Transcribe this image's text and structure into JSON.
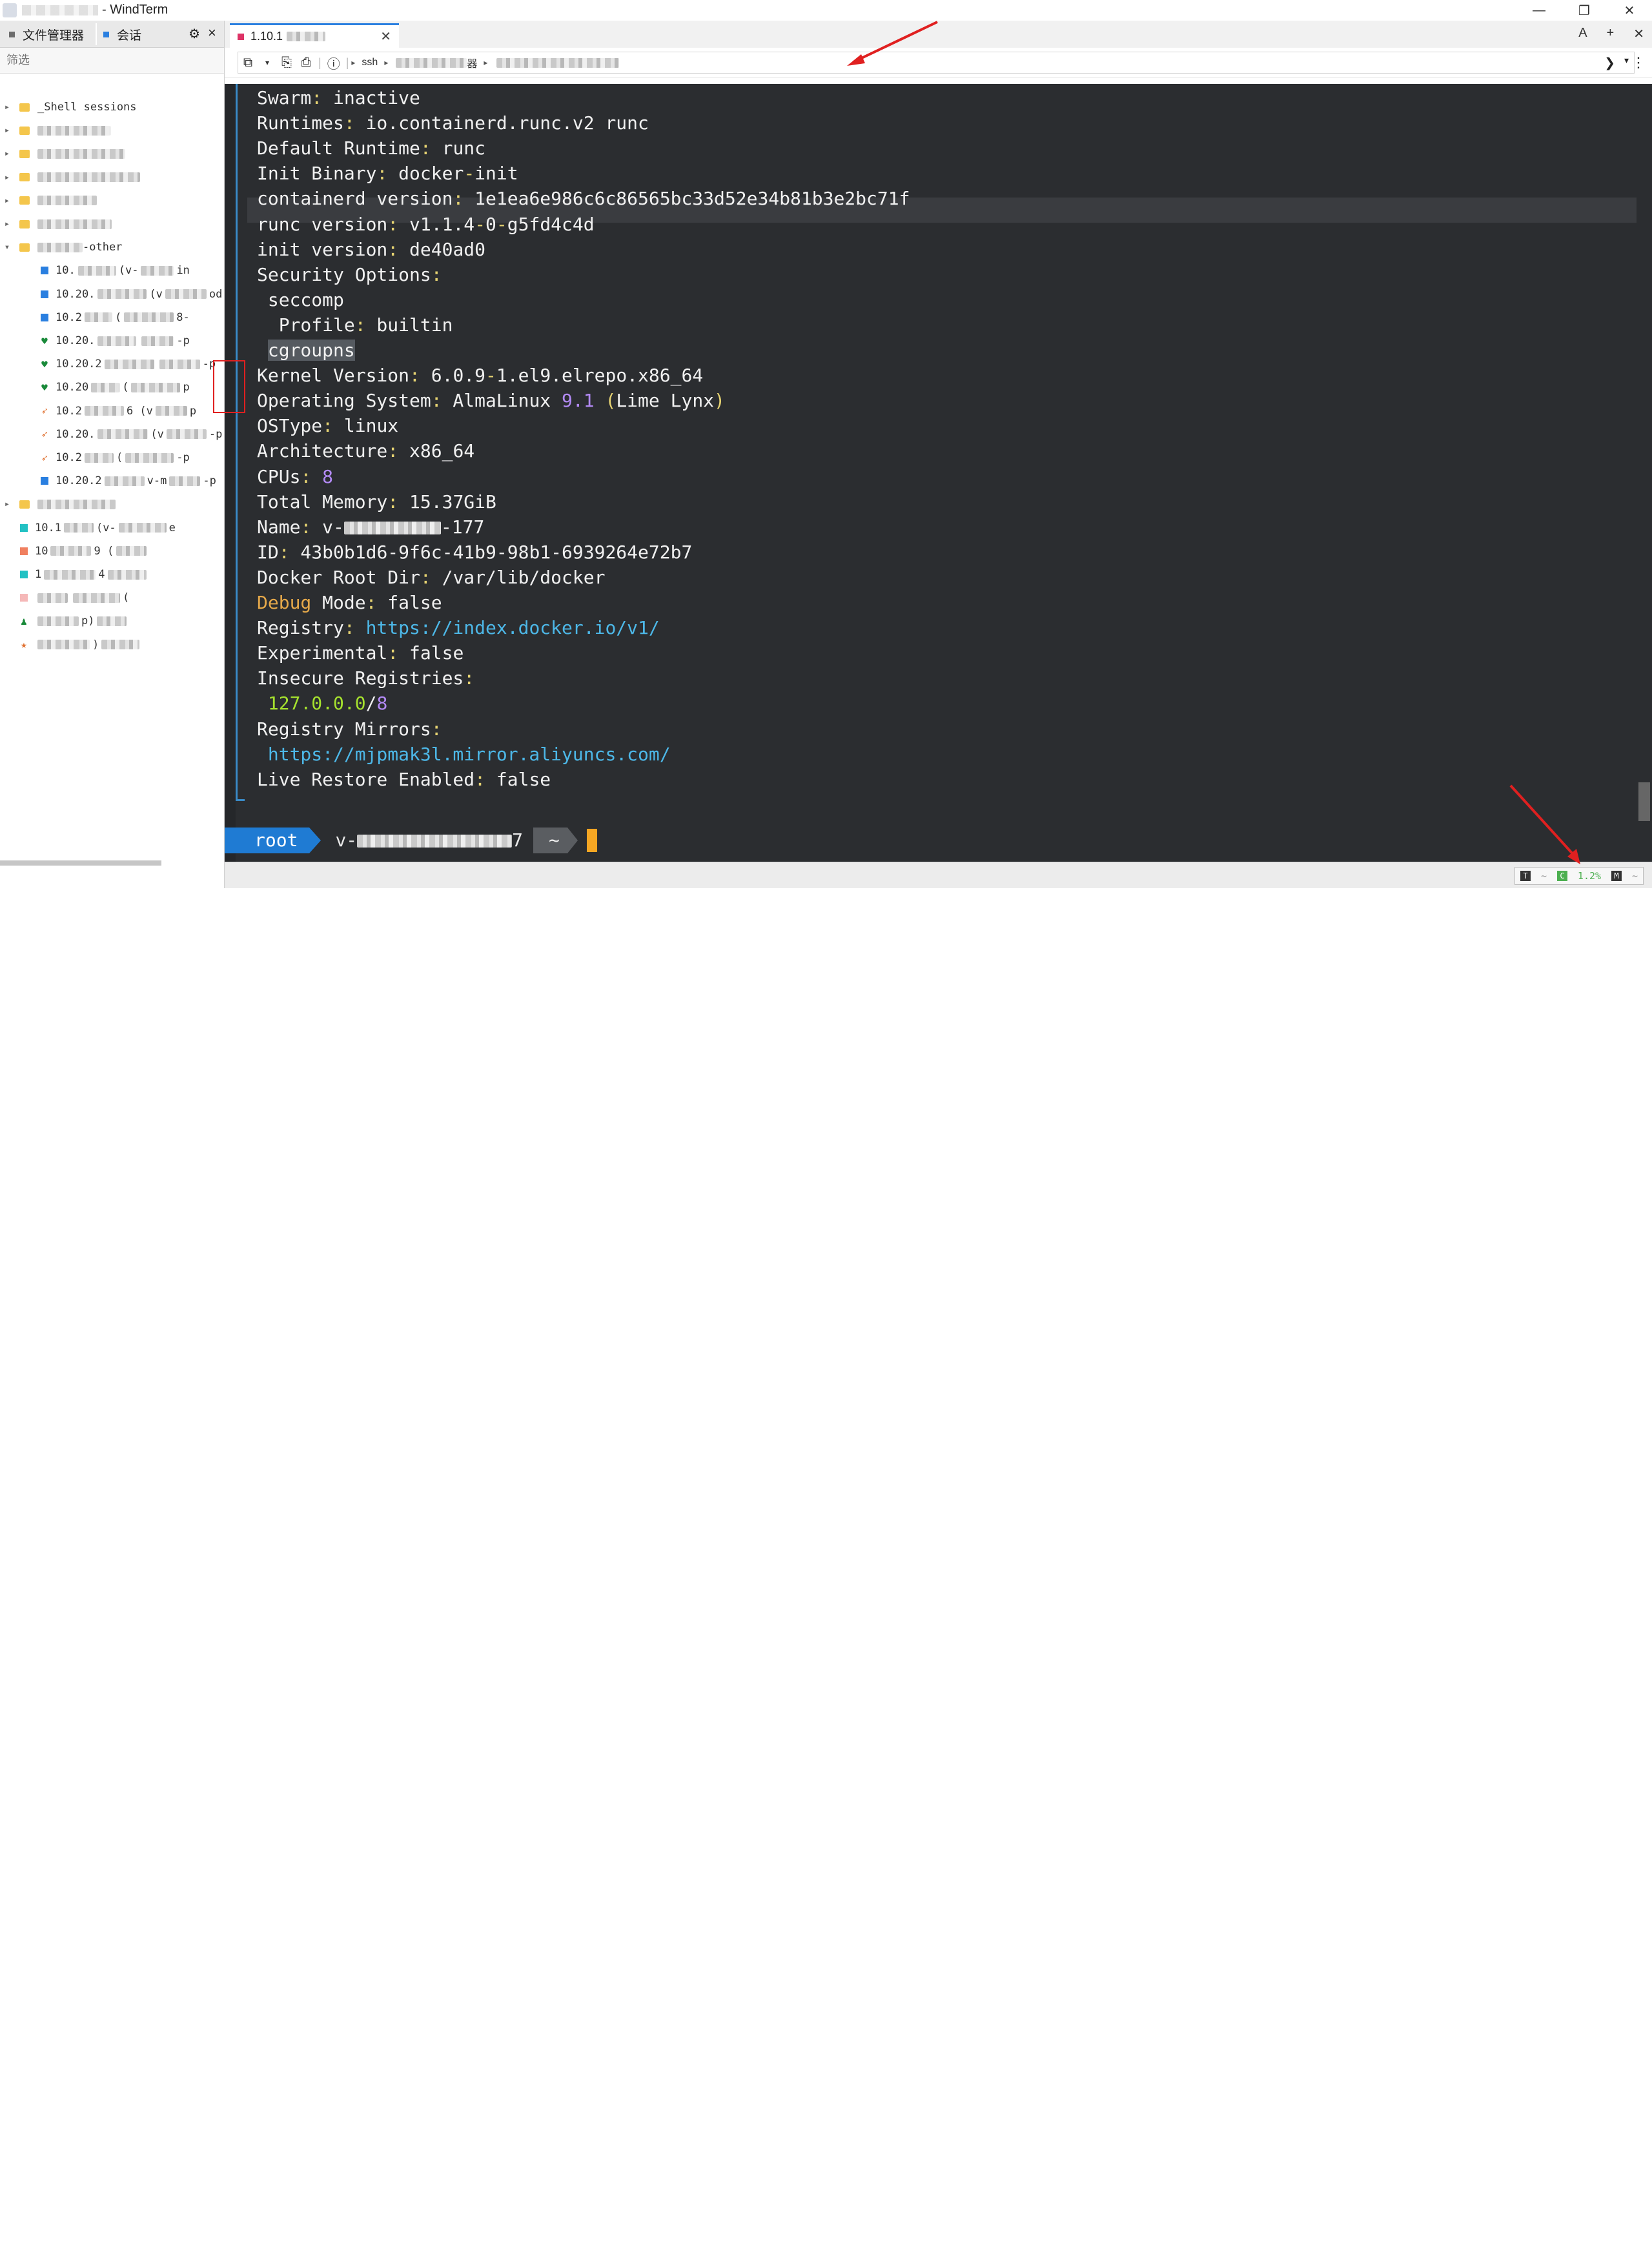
{
  "window": {
    "title": "- WindTerm",
    "controls": [
      "—",
      "❐",
      "✕"
    ]
  },
  "left_panel": {
    "tabs": [
      {
        "label": "文件管理器"
      },
      {
        "label": "会话"
      }
    ],
    "filter_placeholder": "筛选",
    "tree": [
      {
        "type": "folder",
        "label": "_Shell sessions"
      },
      {
        "type": "folder",
        "label": ""
      },
      {
        "type": "folder",
        "label": ""
      },
      {
        "type": "folder",
        "label": ""
      },
      {
        "type": "folder",
        "label": ""
      },
      {
        "type": "folder",
        "label": ""
      },
      {
        "type": "folder_open",
        "label": "-other"
      },
      {
        "type": "session",
        "icon": "square",
        "prefix": "10.",
        "suffix": "(v-",
        "end": "in"
      },
      {
        "type": "session",
        "icon": "square",
        "prefix": "10.20.",
        "suffix": "(v",
        "end": "od"
      },
      {
        "type": "session",
        "icon": "square",
        "prefix": "10.2",
        "suffix": "(",
        "end": "8-"
      },
      {
        "type": "session",
        "icon": "heart",
        "prefix": "10.20.",
        "suffix": "",
        "end": "-p"
      },
      {
        "type": "session",
        "icon": "heart",
        "prefix": "10.20.2",
        "suffix": "",
        "end": "-p"
      },
      {
        "type": "session",
        "icon": "heart",
        "prefix": "10.20",
        "suffix": "(",
        "end": "p"
      },
      {
        "type": "session",
        "icon": "arrow",
        "prefix": "10.2",
        "suffix": "6 (v",
        "end": "p"
      },
      {
        "type": "session",
        "icon": "arrow",
        "prefix": "10.20.",
        "suffix": "(v",
        "end": "-p"
      },
      {
        "type": "session",
        "icon": "arrow",
        "prefix": "10.2",
        "suffix": "(",
        "end": "-p"
      },
      {
        "type": "session",
        "icon": "square",
        "prefix": "10.20.2",
        "suffix": "v-m",
        "end": "-p"
      },
      {
        "type": "folder",
        "label": ""
      },
      {
        "type": "session2",
        "icon": "square-teal",
        "prefix": "10.1",
        "suffix": "(v-",
        "end": "e"
      },
      {
        "type": "session2",
        "icon": "square-red",
        "prefix": "10",
        "suffix": "9 (",
        "end": ""
      },
      {
        "type": "session2",
        "icon": "square-teal",
        "prefix": "1",
        "suffix": "4",
        "end": ""
      },
      {
        "type": "session2",
        "icon": "square-pink",
        "prefix": "",
        "suffix": "",
        "end": "("
      },
      {
        "type": "session2",
        "icon": "person",
        "prefix": "",
        "suffix": "p)",
        "end": ""
      },
      {
        "type": "session2",
        "icon": "star",
        "prefix": "",
        "suffix": ")",
        "end": ""
      }
    ]
  },
  "tab": {
    "label": "1.10.1",
    "close": "✕",
    "right_icons": [
      "A",
      "+",
      "✕"
    ]
  },
  "toolbar": {
    "crumbs": [
      "ssh",
      "器"
    ],
    "info": "ⓘ"
  },
  "terminal": {
    "lines": [
      [
        [
          "k",
          "Swarm"
        ],
        [
          "p",
          ":"
        ],
        [
          "k",
          " inactive"
        ]
      ],
      [
        [
          "k",
          "Runtimes"
        ],
        [
          "p",
          ":"
        ],
        [
          "k",
          " io.containerd.runc.v2 runc"
        ]
      ],
      [
        [
          "k",
          "Default Runtime"
        ],
        [
          "p",
          ":"
        ],
        [
          "k",
          " runc"
        ]
      ],
      [
        [
          "k",
          "Init Binary"
        ],
        [
          "p",
          ":"
        ],
        [
          "k",
          " docker"
        ],
        [
          "p",
          "-"
        ],
        [
          "k",
          "init"
        ]
      ],
      [
        [
          "k",
          "containerd version"
        ],
        [
          "p",
          ":"
        ],
        [
          "k",
          " 1e1ea6e986c6c86565bc33d52e34b81b3e2bc71f"
        ]
      ],
      [
        [
          "k",
          "runc version"
        ],
        [
          "p",
          ":"
        ],
        [
          "k",
          " v1.1.4"
        ],
        [
          "p",
          "-"
        ],
        [
          "k",
          "0"
        ],
        [
          "p",
          "-"
        ],
        [
          "k",
          "g5fd4c4d"
        ]
      ],
      [
        [
          "k",
          "init version"
        ],
        [
          "p",
          ":"
        ],
        [
          "k",
          " de40ad0"
        ]
      ],
      [
        [
          "k",
          "Security Options"
        ],
        [
          "p",
          ":"
        ]
      ],
      [
        [
          "k",
          " seccomp"
        ]
      ],
      [
        [
          "k",
          "  Profile"
        ],
        [
          "p",
          ":"
        ],
        [
          "k",
          " builtin"
        ]
      ],
      [
        [
          "k",
          " "
        ],
        [
          "sel",
          "cgroupns"
        ]
      ],
      [
        [
          "k",
          "Kernel Version"
        ],
        [
          "p",
          ":"
        ],
        [
          "k",
          " 6.0.9"
        ],
        [
          "p",
          "-"
        ],
        [
          "k",
          "1.el9.elrepo.x86_64"
        ]
      ],
      [
        [
          "k",
          "Operating System"
        ],
        [
          "p",
          ":"
        ],
        [
          "k",
          " AlmaLinux "
        ],
        [
          "n",
          "9.1"
        ],
        [
          "k",
          " "
        ],
        [
          "p",
          "("
        ],
        [
          "k",
          "Lime Lynx"
        ],
        [
          "p",
          ")"
        ]
      ],
      [
        [
          "k",
          "OSType"
        ],
        [
          "p",
          ":"
        ],
        [
          "k",
          " linux"
        ]
      ],
      [
        [
          "k",
          "Architecture"
        ],
        [
          "p",
          ":"
        ],
        [
          "k",
          " x86_64"
        ]
      ],
      [
        [
          "k",
          "CPUs"
        ],
        [
          "p",
          ":"
        ],
        [
          "n",
          " 8"
        ]
      ],
      [
        [
          "k",
          "Total Memory"
        ],
        [
          "p",
          ":"
        ],
        [
          "k",
          " 15.37GiB"
        ]
      ],
      [
        [
          "k",
          "Name"
        ],
        [
          "p",
          ":"
        ],
        [
          "k",
          " v-"
        ],
        [
          "blur",
          ""
        ],
        [
          "k",
          "-177"
        ]
      ],
      [
        [
          "k",
          "ID"
        ],
        [
          "p",
          ":"
        ],
        [
          "k",
          " 43b0b1d6-9f6c-41b9-98b1-6939264e72b7"
        ]
      ],
      [
        [
          "k",
          "Docker Root Dir"
        ],
        [
          "p",
          ":"
        ],
        [
          "k",
          " /var/lib/docker"
        ]
      ],
      [
        [
          "o",
          "Debug"
        ],
        [
          "k",
          " Mode"
        ],
        [
          "p",
          ":"
        ],
        [
          "k",
          " false"
        ]
      ],
      [
        [
          "k",
          "Registry"
        ],
        [
          "p",
          ":"
        ],
        [
          "u",
          " https://index.docker.io/v1/"
        ]
      ],
      [
        [
          "k",
          "Experimental"
        ],
        [
          "p",
          ":"
        ],
        [
          "k",
          " false"
        ]
      ],
      [
        [
          "k",
          "Insecure Registries"
        ],
        [
          "p",
          ":"
        ]
      ],
      [
        [
          "g",
          " 127.0.0.0"
        ],
        [
          "k",
          "/"
        ],
        [
          "n",
          "8"
        ]
      ],
      [
        [
          "k",
          "Registry Mirrors"
        ],
        [
          "p",
          ":"
        ]
      ],
      [
        [
          "u",
          " https://mjpmak3l.mirror.aliyuncs.com/"
        ]
      ],
      [
        [
          "k",
          "Live Restore Enabled"
        ],
        [
          "p",
          ":"
        ],
        [
          "k",
          " false"
        ]
      ]
    ],
    "prompt": {
      "user": "root",
      "host": "v-",
      "host_end": "7",
      "dir": "~"
    }
  },
  "statusbar": {
    "t_label": "T",
    "c_label": "C",
    "cpu": "1.2%",
    "m_label": "M"
  },
  "colors": {
    "terminal_bg": "#2b2d30",
    "accent": "#1f7bd3",
    "punct": "#e6d372",
    "number": "#b38af5",
    "url": "#4db8e8",
    "annotation": "#e02020"
  }
}
